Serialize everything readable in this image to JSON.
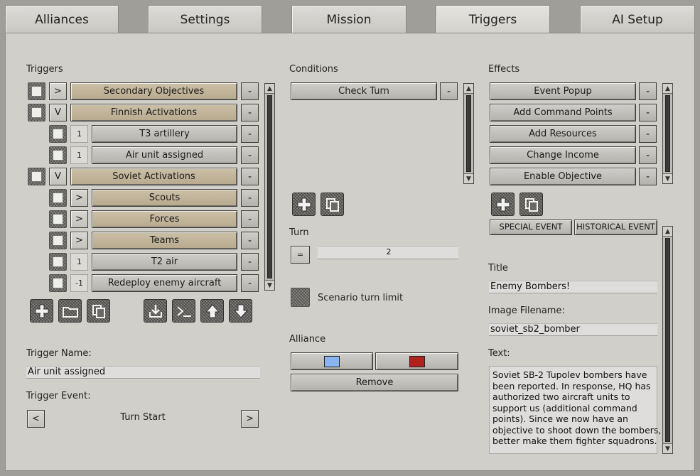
{
  "tabs": [
    "Alliances",
    "Settings",
    "Mission",
    "Triggers",
    "AI Setup"
  ],
  "triggers": {
    "heading": "Triggers",
    "rows": [
      {
        "toggle": ">",
        "label": "Secondary Objectives",
        "style": "tan",
        "indent": 0
      },
      {
        "toggle": "V",
        "label": "Finnish Activations",
        "style": "tan",
        "indent": 0
      },
      {
        "num": "1",
        "label": "T3 artillery",
        "style": "grey",
        "indent": 1
      },
      {
        "num": "1",
        "label": "Air unit assigned",
        "style": "grey",
        "indent": 1
      },
      {
        "toggle": "V",
        "label": "Soviet Activations",
        "style": "tan",
        "indent": 0
      },
      {
        "toggle": ">",
        "label": "Scouts",
        "style": "tan",
        "indent": 1
      },
      {
        "toggle": ">",
        "label": "Forces",
        "style": "tan",
        "indent": 1
      },
      {
        "toggle": ">",
        "label": "Teams",
        "style": "tan",
        "indent": 1
      },
      {
        "num": "1",
        "label": "T2 air",
        "style": "grey",
        "indent": 1
      },
      {
        "num": "-1",
        "label": "Redeploy enemy aircraft",
        "style": "grey",
        "indent": 1
      }
    ],
    "remove_glyph": "-",
    "toolbar_icons": [
      "plus-icon",
      "folder-icon",
      "copy-icon",
      "import-icon",
      "console-icon",
      "arrow-up-icon",
      "arrow-down-icon"
    ]
  },
  "trigger_name": {
    "label": "Trigger Name:",
    "value": "Air unit assigned"
  },
  "trigger_event": {
    "label": "Trigger Event:",
    "value": "Turn Start",
    "prev": "<",
    "next": ">"
  },
  "conditions": {
    "heading": "Conditions",
    "items": [
      "Check Turn"
    ]
  },
  "turn": {
    "label": "Turn",
    "operator": "=",
    "value": "2"
  },
  "scenario_limit": {
    "label": "Scenario turn limit"
  },
  "alliance": {
    "label": "Alliance",
    "colors": [
      "#8ab4f0",
      "#b2221d"
    ],
    "remove_label": "Remove"
  },
  "effects": {
    "heading": "Effects",
    "items": [
      "Event Popup",
      "Add Command Points",
      "Add Resources",
      "Change Income",
      "Enable Objective"
    ],
    "special_event": "SPECIAL EVENT",
    "historical_event": "HISTORICAL EVENT"
  },
  "popup": {
    "title_label": "Title",
    "title_value": "Enemy Bombers!",
    "image_label": "Image Filename:",
    "image_value": "soviet_sb2_bomber",
    "text_label": "Text:",
    "text_lines": [
      "Soviet SB-2 Tupolev bombers have",
      "been reported. In response, HQ has",
      "authorized two aircraft units to",
      "support us (additional command",
      "points). Since we now have an",
      "objective to shoot down the bombers,",
      "better make them fighter squadrons."
    ]
  }
}
